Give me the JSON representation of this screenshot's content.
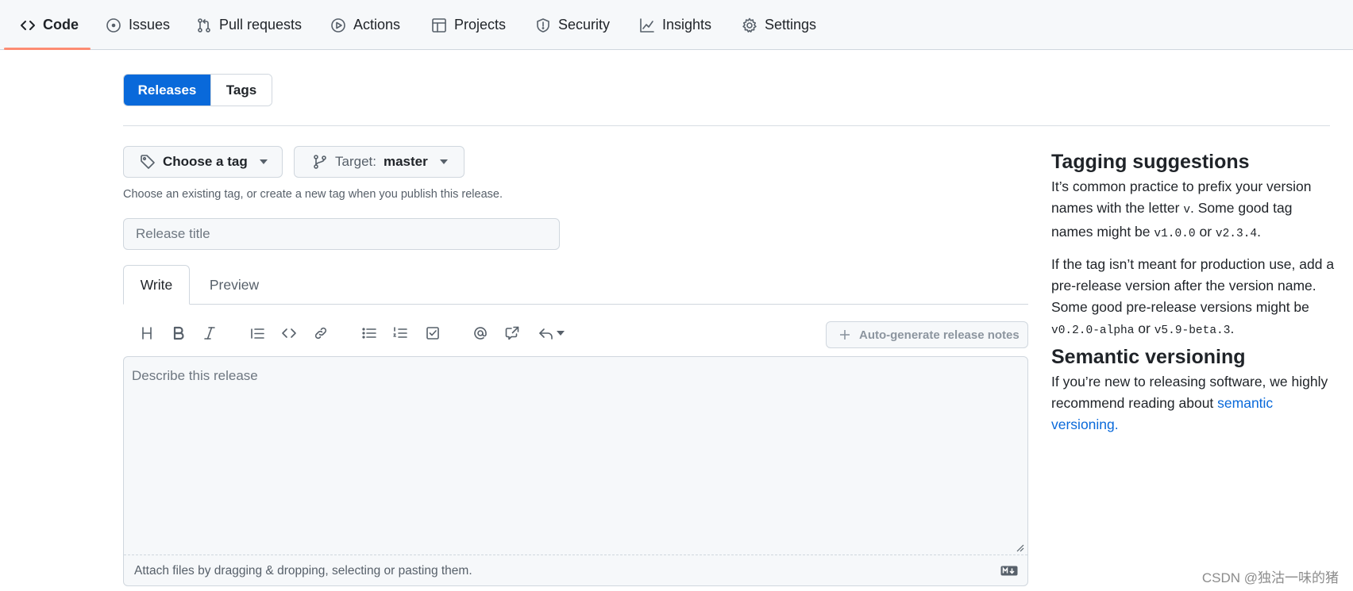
{
  "nav": {
    "tabs": [
      {
        "label": "Code",
        "icon": "code-icon",
        "active": true
      },
      {
        "label": "Issues",
        "icon": "issue-opened-icon"
      },
      {
        "label": "Pull requests",
        "icon": "git-pull-request-icon"
      },
      {
        "label": "Actions",
        "icon": "play-icon"
      },
      {
        "label": "Projects",
        "icon": "table-icon"
      },
      {
        "label": "Security",
        "icon": "shield-icon"
      },
      {
        "label": "Insights",
        "icon": "graph-icon"
      },
      {
        "label": "Settings",
        "icon": "gear-icon"
      }
    ],
    "active_underline_color": "#fd8c73"
  },
  "segmented": {
    "releases": "Releases",
    "tags": "Tags",
    "active_color": "#0969da"
  },
  "tag_picker": {
    "label": "Choose a tag"
  },
  "target": {
    "label": "Target:",
    "value": "master"
  },
  "tag_hint": "Choose an existing tag, or create a new tag when you publish this release.",
  "release_title": {
    "placeholder": "Release title",
    "value": ""
  },
  "editor_tabs": {
    "write": "Write",
    "preview": "Preview"
  },
  "toolbar": {
    "tools": [
      "heading-icon",
      "bold-icon",
      "italic-icon",
      "quote-icon",
      "code-icon",
      "link-icon",
      "unordered-list-icon",
      "ordered-list-icon",
      "task-list-icon",
      "mention-icon",
      "cross-reference-icon",
      "reply-icon"
    ],
    "auto_generate": "Auto-generate release notes"
  },
  "editor": {
    "placeholder": "Describe this release",
    "attach_hint": "Attach files by dragging & dropping, selecting or pasting them."
  },
  "sidebar": {
    "tagging": {
      "heading": "Tagging suggestions",
      "p1_a": "It’s common practice to prefix your version names with the letter ",
      "p1_code1": "v",
      "p1_b": ". Some good tag names might be ",
      "p1_code2": "v1.0.0",
      "p1_c": " or ",
      "p1_code3": "v2.3.4",
      "p1_d": ".",
      "p2_a": "If the tag isn’t meant for production use, add a pre-release version after the version name. Some good pre-release versions might be ",
      "p2_code1": "v0.2.0-alpha",
      "p2_b": " or ",
      "p2_code2": "v5.9-beta.3",
      "p2_c": "."
    },
    "semver": {
      "heading": "Semantic versioning",
      "text": "If you’re new to releasing software, we highly recommend reading about ",
      "link": "semantic versioning.",
      "link_color": "#0969da"
    }
  },
  "watermark": "CSDN @独沽一味的猪"
}
